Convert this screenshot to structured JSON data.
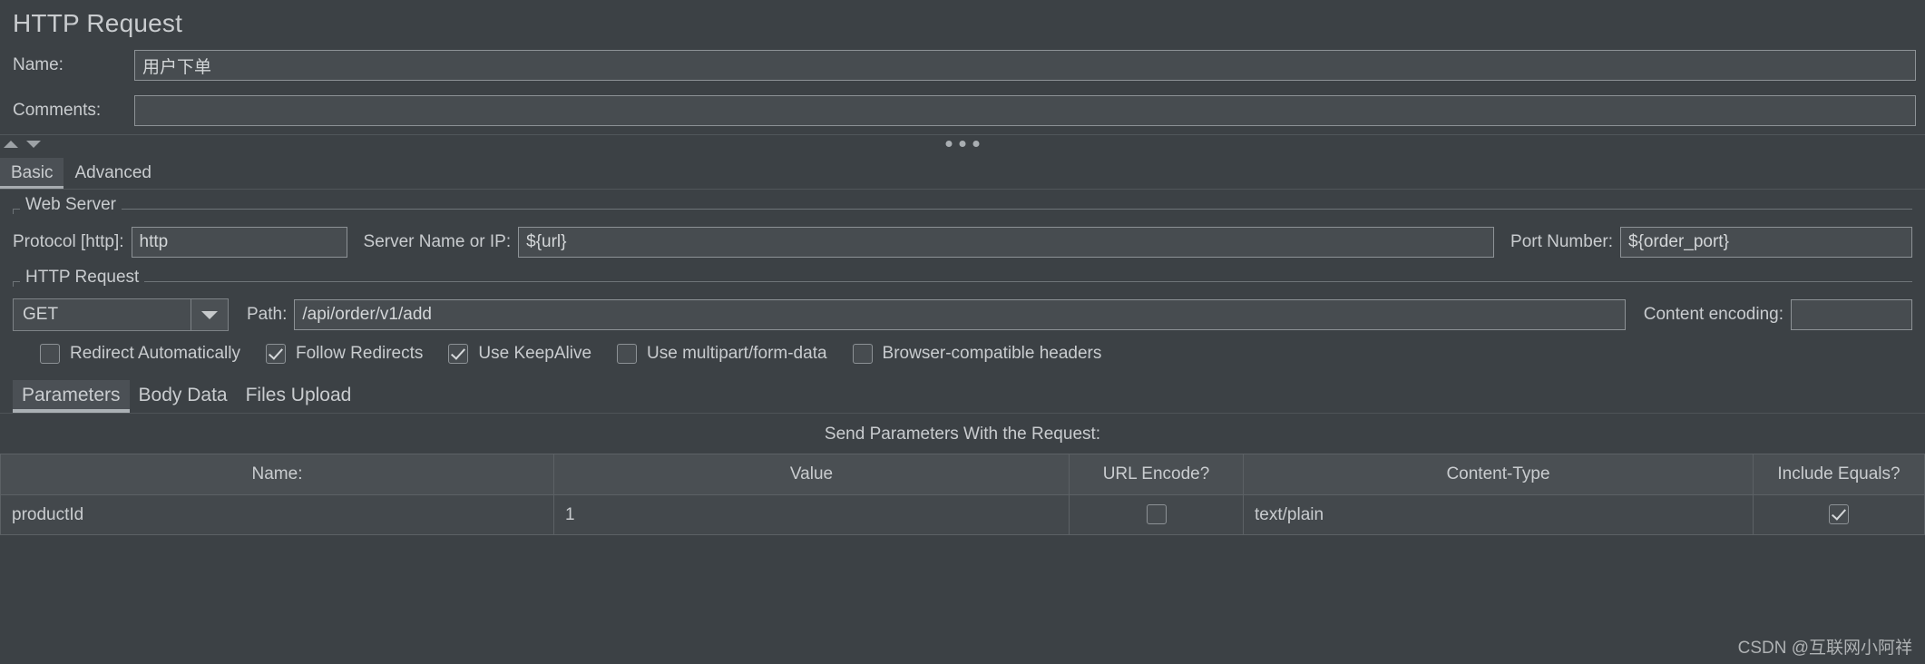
{
  "header": {
    "title": "HTTP Request",
    "name_label": "Name:",
    "name_value": "用户下单",
    "comments_label": "Comments:",
    "comments_value": ""
  },
  "outer_tabs": [
    {
      "label": "Basic",
      "active": true
    },
    {
      "label": "Advanced",
      "active": false
    }
  ],
  "web_server": {
    "group_title": "Web Server",
    "protocol_label": "Protocol [http]:",
    "protocol_value": "http",
    "server_label": "Server Name or IP:",
    "server_value": "${url}",
    "port_label": "Port Number:",
    "port_value": "${order_port}"
  },
  "http_request": {
    "group_title": "HTTP Request",
    "method_value": "GET",
    "path_label": "Path:",
    "path_value": "/api/order/v1/add",
    "content_encoding_label": "Content encoding:",
    "content_encoding_value": ""
  },
  "checkboxes": [
    {
      "label": "Redirect Automatically",
      "checked": false
    },
    {
      "label": "Follow Redirects",
      "checked": true
    },
    {
      "label": "Use KeepAlive",
      "checked": true
    },
    {
      "label": "Use multipart/form-data",
      "checked": false
    },
    {
      "label": "Browser-compatible headers",
      "checked": false
    }
  ],
  "inner_tabs": [
    {
      "label": "Parameters",
      "active": true
    },
    {
      "label": "Body Data",
      "active": false
    },
    {
      "label": "Files Upload",
      "active": false
    }
  ],
  "params_table": {
    "caption": "Send Parameters With the Request:",
    "columns": [
      "Name:",
      "Value",
      "URL Encode?",
      "Content-Type",
      "Include Equals?"
    ],
    "rows": [
      {
        "name": "productId",
        "value": "1",
        "url_encode": false,
        "content_type": "text/plain",
        "include_equals": true
      }
    ]
  },
  "watermark": {
    "text": "CSDN @互联网小阿祥"
  },
  "colors": {
    "background": "#3c4145",
    "field_bg": "#474c50",
    "field_border": "#8d9296",
    "text": "#c9cccf",
    "tab_active_bg": "#4b5055",
    "tab_indicator": "#aab0b4",
    "table_header_bg": "#4a4f53",
    "table_cell_bg": "#43484c",
    "grid_line": "#5c6165"
  }
}
